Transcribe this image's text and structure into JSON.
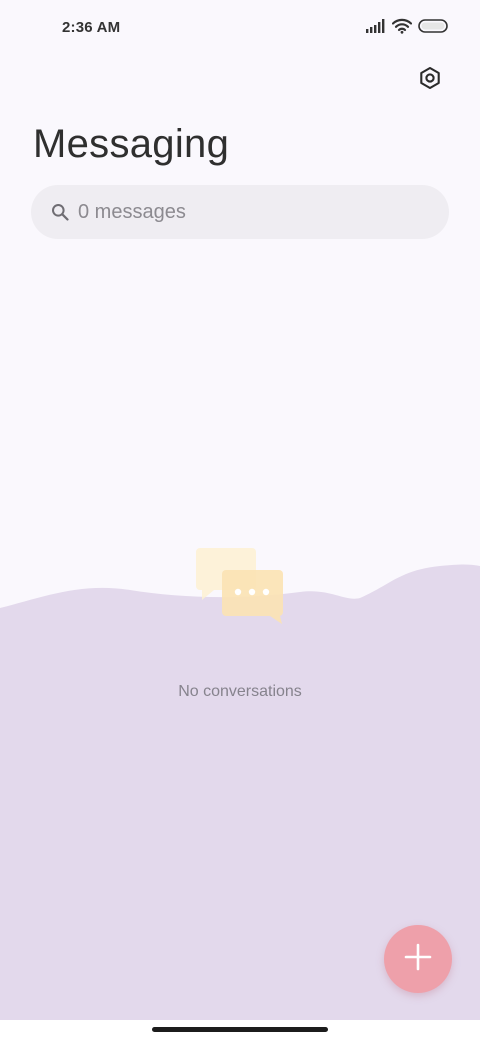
{
  "status_bar": {
    "time": "2:36 AM",
    "icons": [
      "signal-icon",
      "wifi-icon",
      "battery-icon"
    ]
  },
  "header": {
    "title": "Messaging",
    "settings_icon": "settings-icon"
  },
  "search": {
    "placeholder": "0 messages",
    "icon": "search-icon"
  },
  "empty_state": {
    "icon": "chat-bubbles-icon",
    "text": "No conversations"
  },
  "fab": {
    "icon": "plus-icon"
  },
  "colors": {
    "background": "#faf8fd",
    "wave": "#e3d9ec",
    "search_bg": "#efedf2",
    "fab": "#eea0aa",
    "bubble_back": "#fdf1d2",
    "bubble_front": "#fbe3b4"
  }
}
